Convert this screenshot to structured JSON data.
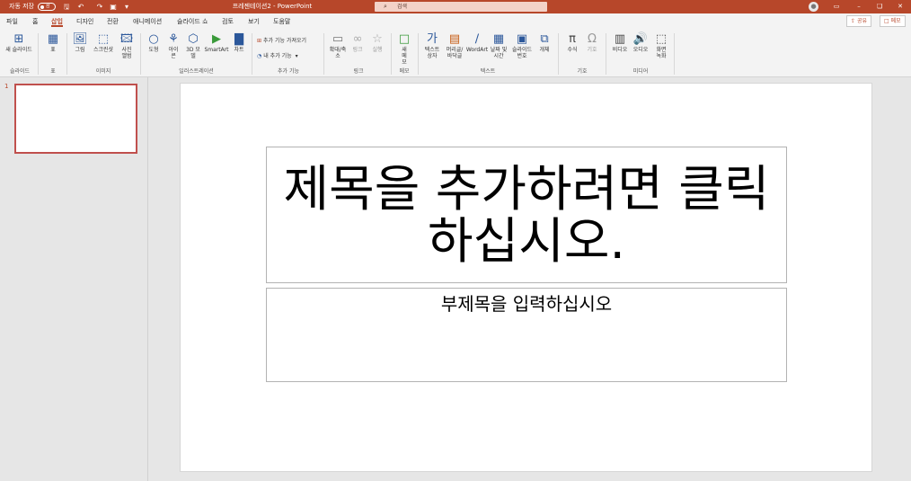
{
  "titlebar": {
    "autosave_label": "자동 저장",
    "autosave_state": "끔",
    "doc_title": "프레젠테이션2 - PowerPoint",
    "search_placeholder": "검색",
    "qat_icons": [
      "save-icon",
      "undo-icon",
      "redo-icon",
      "present-icon",
      "customize-icon"
    ],
    "window_icons": [
      "ribbon-display-icon",
      "minimize-icon",
      "restore-icon",
      "close-icon"
    ]
  },
  "tabs": [
    "파일",
    "홈",
    "삽입",
    "디자인",
    "전환",
    "애니메이션",
    "슬라이드 쇼",
    "검토",
    "보기",
    "도움말"
  ],
  "active_tab": "삽입",
  "share_label": "공유",
  "comment_label": "메모",
  "ribbon": {
    "slides": {
      "new_slide": "새 슬라이드",
      "group": "슬라이드"
    },
    "tables": {
      "table": "표",
      "group": "표"
    },
    "images": {
      "picture": "그림",
      "screenshot": "스크린샷",
      "album": "사진 앨범",
      "group": "이미지"
    },
    "illustrations": {
      "shapes": "도형",
      "icons": "아이콘",
      "models3d": "3D 모델",
      "smartart": "SmartArt",
      "chart": "차트",
      "group": "일러스트레이션"
    },
    "addins": {
      "get_addins": "추가 기능 가져오기",
      "my_addins": "내 추가 기능",
      "group": "추가 기능"
    },
    "links": {
      "zoom": "확대/축소",
      "link": "링크",
      "action": "실행",
      "group": "링크"
    },
    "comments": {
      "comment": "새 메모",
      "group": "메모"
    },
    "text": {
      "textbox": "텍스트 상자",
      "header_footer": "머리글/바닥글",
      "wordart": "WordArt",
      "datetime": "날짜 및 시간",
      "slide_number": "슬라이드 번호",
      "object": "개체",
      "group": "텍스트"
    },
    "symbols": {
      "equation": "수식",
      "symbol": "기호",
      "group": "기호"
    },
    "media": {
      "video": "비디오",
      "audio": "오디오",
      "screen_recording": "화면 녹화",
      "group": "미디어"
    }
  },
  "thumbnail": {
    "number": "1"
  },
  "slide": {
    "title_placeholder": "제목을 추가하려면 클릭하십시오.",
    "subtitle_placeholder": "부제목을 입력하십시오"
  },
  "colors": {
    "accent": "#b7472a",
    "icon_blue": "#2b579a"
  }
}
